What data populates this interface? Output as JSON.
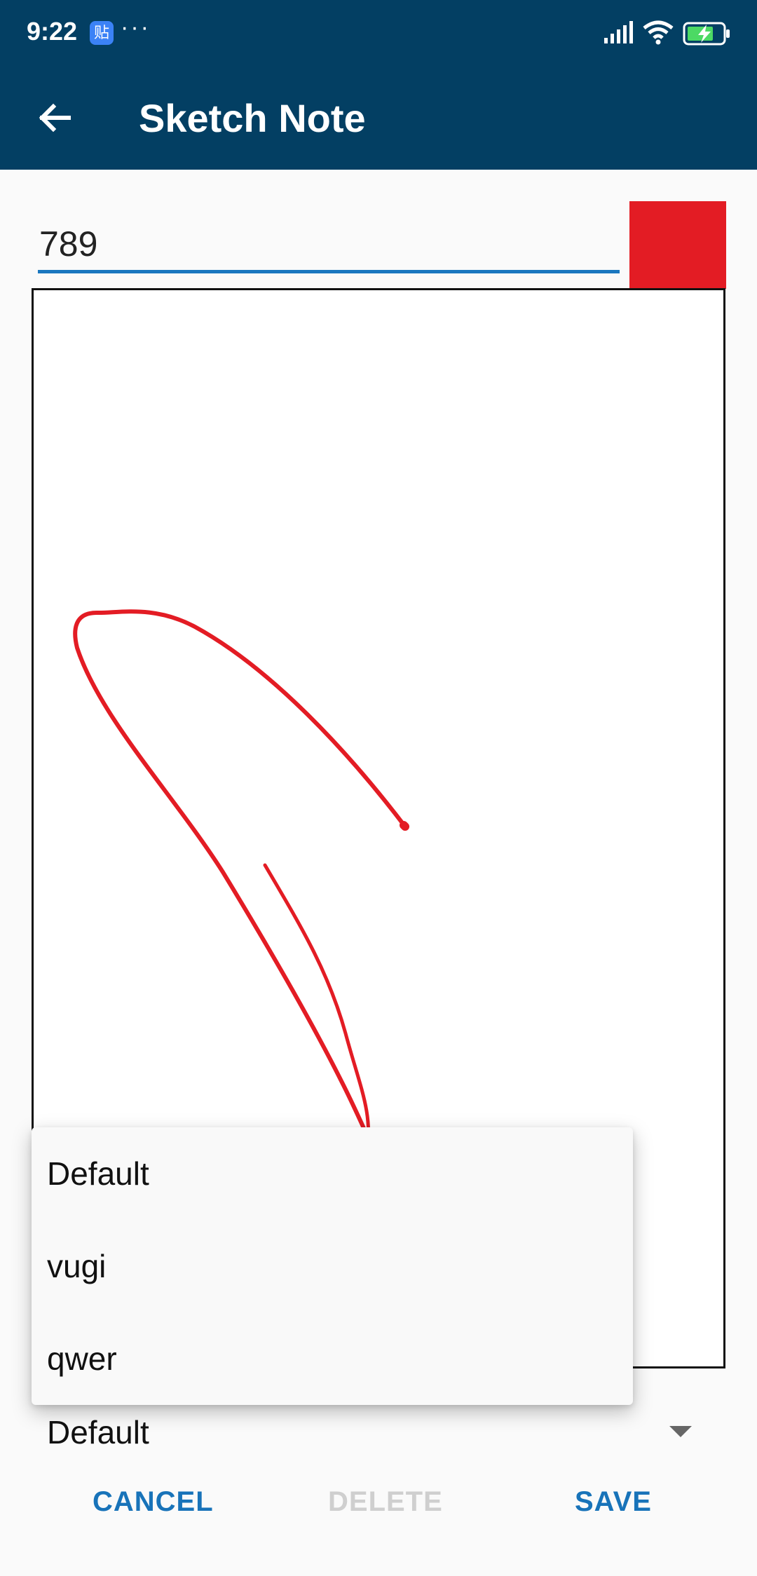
{
  "status_bar": {
    "time": "9:22",
    "notification_icon": "tieba-app-icon",
    "notification_glyph": "贴",
    "more_dots": "···",
    "icons": [
      "signal-icon",
      "wifi-icon",
      "battery-charging-icon"
    ]
  },
  "app_bar": {
    "back_icon": "arrow-left-icon",
    "title": "Sketch Note"
  },
  "note": {
    "title_value": "789",
    "color": "#e31c24"
  },
  "dropdown": {
    "options": [
      "Default",
      "vugi",
      "qwer"
    ]
  },
  "category": {
    "selected": "Default"
  },
  "actions": {
    "cancel": "CANCEL",
    "delete": "DELETE",
    "save": "SAVE"
  },
  "colors": {
    "primary_dark": "#033f63",
    "accent": "#1873b9",
    "stroke": "#e31c24",
    "disabled": "#cfcfcf"
  }
}
